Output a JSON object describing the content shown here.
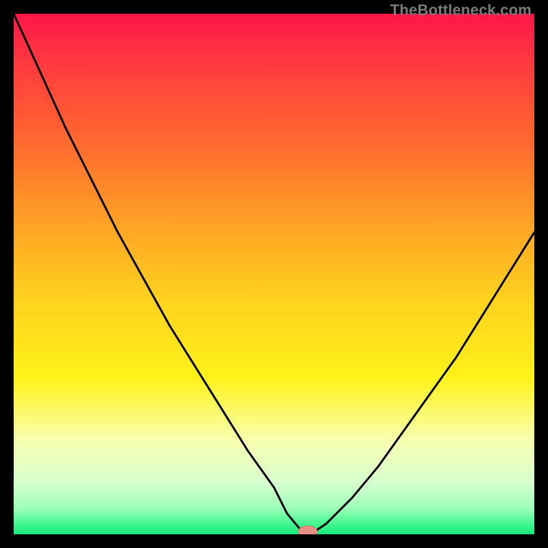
{
  "watermark": "TheBottleneck.com",
  "colors": {
    "black": "#000000",
    "curve": "#000000",
    "marker_fill": "#e98f86",
    "marker_stroke": "#d2786f",
    "gradient_stops": [
      {
        "offset": 0.0,
        "color": "#ff1649"
      },
      {
        "offset": 0.1,
        "color": "#ff3b3f"
      },
      {
        "offset": 0.25,
        "color": "#ff6a2f"
      },
      {
        "offset": 0.4,
        "color": "#ffa125"
      },
      {
        "offset": 0.55,
        "color": "#ffd21e"
      },
      {
        "offset": 0.7,
        "color": "#fff21a"
      },
      {
        "offset": 0.82,
        "color": "#f7ffb0"
      },
      {
        "offset": 0.9,
        "color": "#d8ffcf"
      },
      {
        "offset": 0.95,
        "color": "#9dffb8"
      },
      {
        "offset": 0.985,
        "color": "#35f58a"
      },
      {
        "offset": 1.0,
        "color": "#18e676"
      }
    ]
  },
  "chart_data": {
    "type": "line",
    "title": "",
    "xlabel": "",
    "ylabel": "",
    "x": [
      0.0,
      0.05,
      0.1,
      0.15,
      0.2,
      0.25,
      0.3,
      0.35,
      0.4,
      0.45,
      0.5,
      0.525,
      0.55,
      0.56,
      0.57,
      0.6,
      0.65,
      0.7,
      0.75,
      0.8,
      0.85,
      0.9,
      0.95,
      1.0
    ],
    "values": [
      100,
      89,
      78,
      68,
      58,
      49,
      40,
      32,
      24,
      16,
      9,
      4,
      1,
      0,
      0,
      2,
      7,
      13,
      20,
      27,
      34,
      42,
      50,
      58
    ],
    "xlim": [
      0,
      1
    ],
    "ylim": [
      0,
      100
    ],
    "marker": {
      "x": 0.565,
      "y": 0,
      "rx": 0.018,
      "ry": 0.011
    }
  }
}
